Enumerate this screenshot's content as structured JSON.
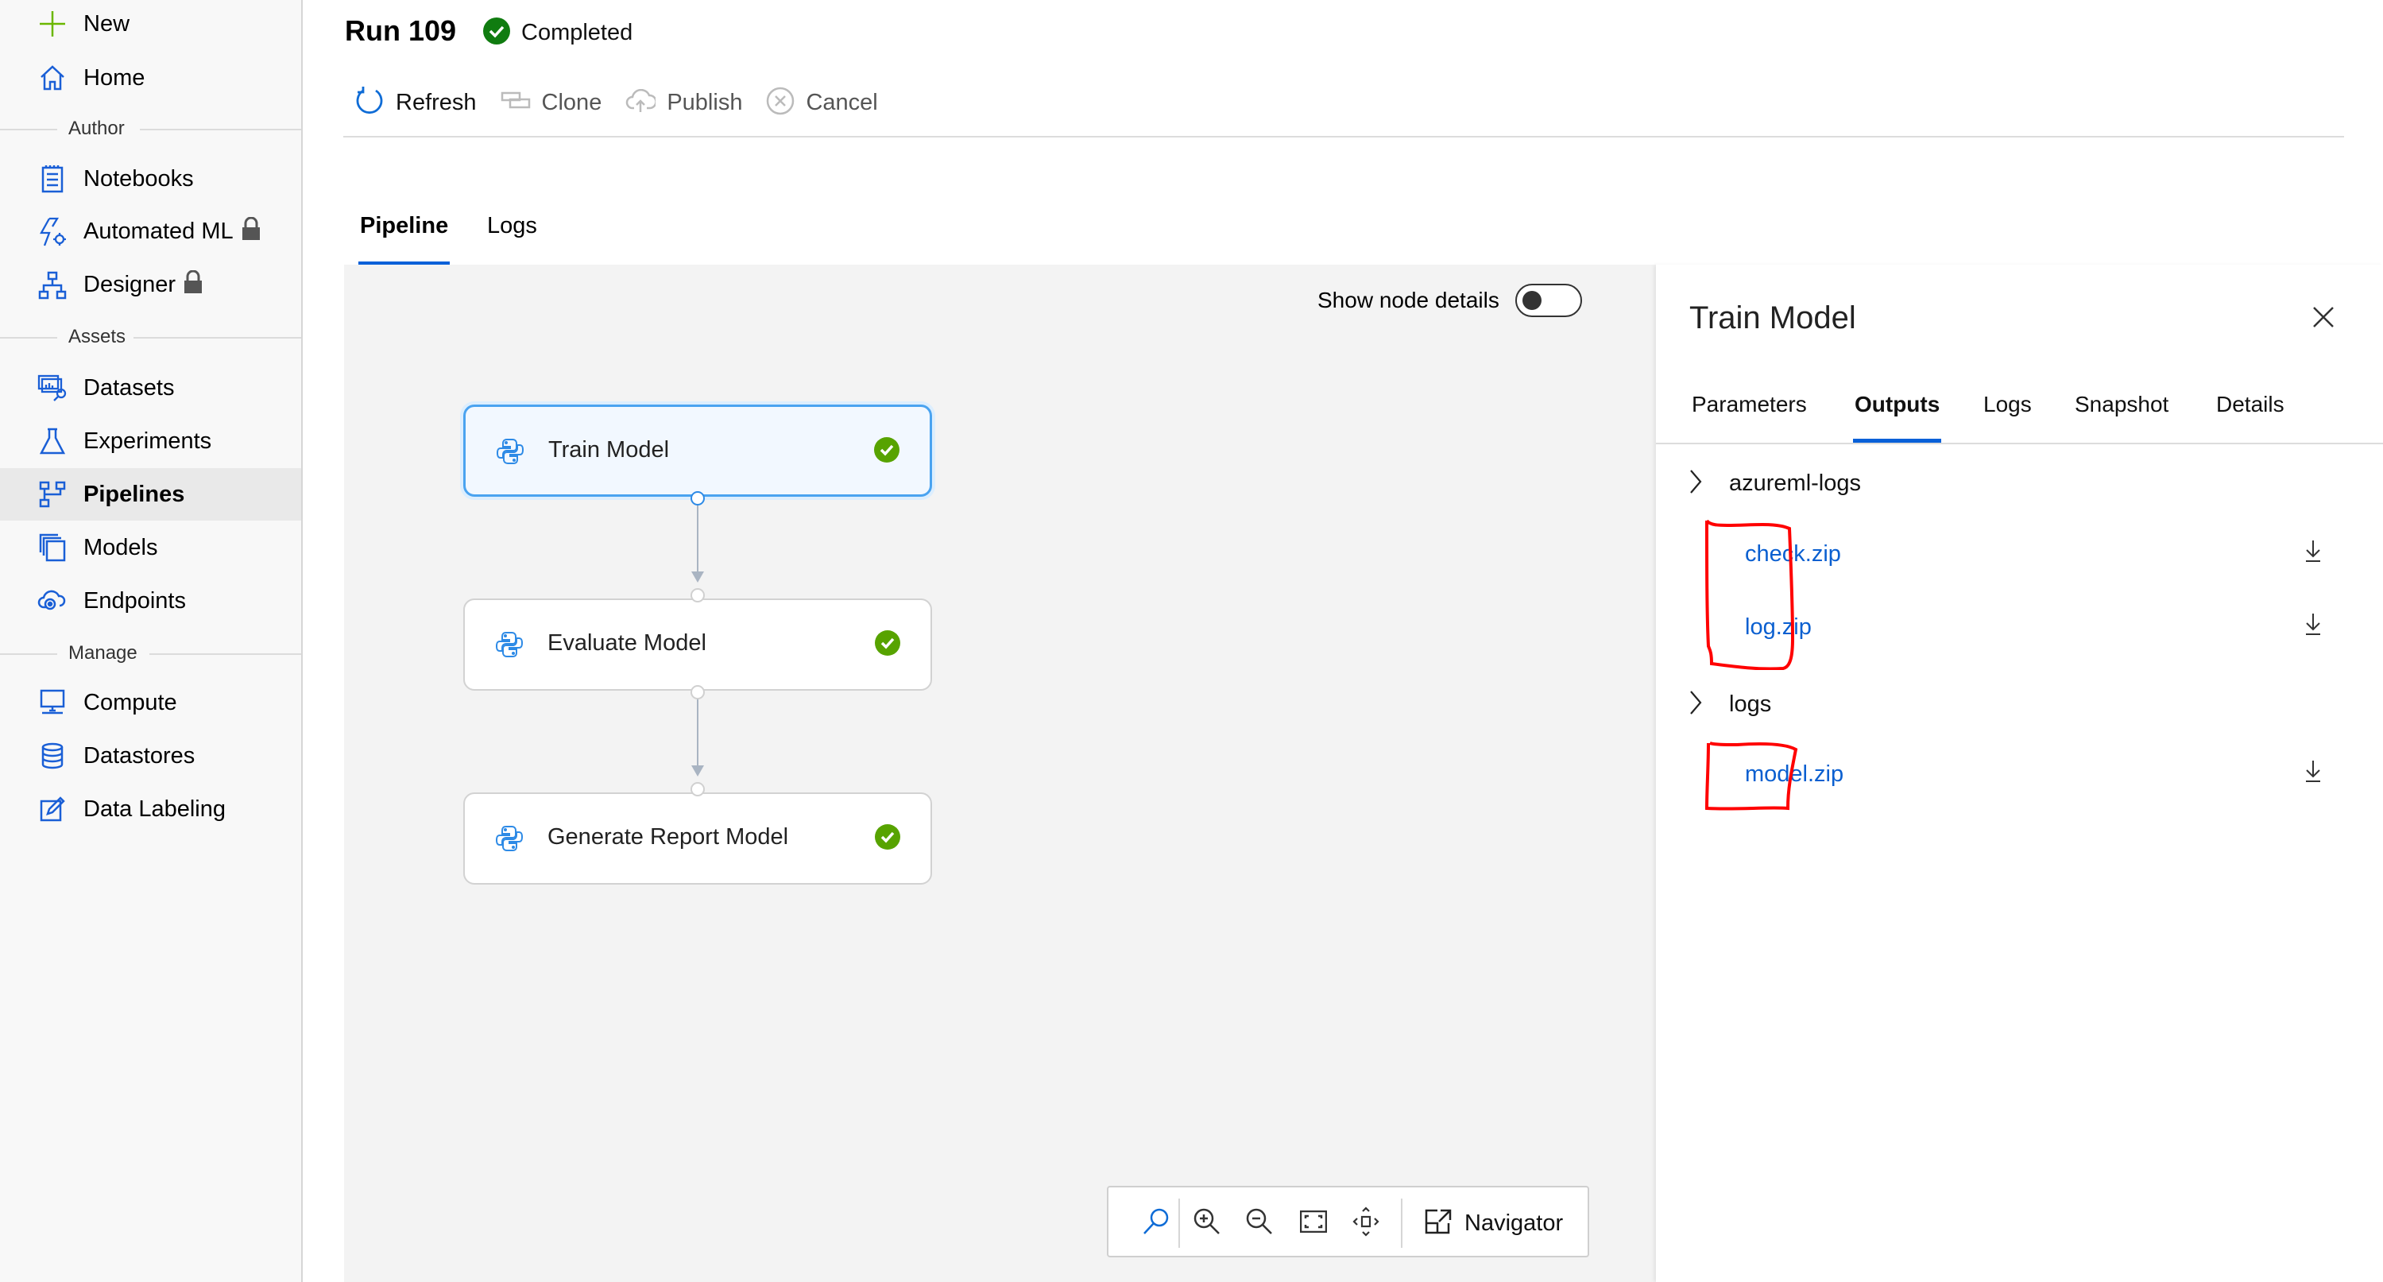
{
  "sidebar": {
    "new_label": "New",
    "home_label": "Home",
    "sections": {
      "author": "Author",
      "assets": "Assets",
      "manage": "Manage"
    },
    "items": [
      {
        "label": "Notebooks",
        "icon": "notebook-icon"
      },
      {
        "label": "Automated ML",
        "icon": "automated-ml-icon",
        "locked": true
      },
      {
        "label": "Designer",
        "icon": "designer-icon",
        "locked": true
      },
      {
        "label": "Datasets",
        "icon": "datasets-icon"
      },
      {
        "label": "Experiments",
        "icon": "flask-icon"
      },
      {
        "label": "Pipelines",
        "icon": "pipeline-icon",
        "active": true
      },
      {
        "label": "Models",
        "icon": "models-icon"
      },
      {
        "label": "Endpoints",
        "icon": "endpoints-icon"
      },
      {
        "label": "Compute",
        "icon": "compute-icon"
      },
      {
        "label": "Datastores",
        "icon": "database-icon"
      },
      {
        "label": "Data Labeling",
        "icon": "edit-icon"
      }
    ]
  },
  "header": {
    "title": "Run 109",
    "status": "Completed",
    "status_color": "#107c10"
  },
  "toolbar": {
    "refresh": "Refresh",
    "clone": "Clone",
    "publish": "Publish",
    "cancel": "Cancel"
  },
  "tabs": [
    {
      "label": "Pipeline",
      "active": true
    },
    {
      "label": "Logs"
    }
  ],
  "canvas": {
    "show_node_details_label": "Show node details",
    "show_node_details_on": false,
    "nodes": [
      {
        "name": "Train Model",
        "status": "completed",
        "selected": true
      },
      {
        "name": "Evaluate Model",
        "status": "completed"
      },
      {
        "name": "Generate Report Model",
        "status": "completed"
      }
    ],
    "navigator_label": "Navigator"
  },
  "panel": {
    "title": "Train Model",
    "tabs": [
      {
        "label": "Parameters"
      },
      {
        "label": "Outputs",
        "active": true
      },
      {
        "label": "Logs"
      },
      {
        "label": "Snapshot"
      },
      {
        "label": "Details"
      }
    ],
    "outputs": {
      "folders": [
        {
          "name": "azureml-logs",
          "files": [
            "check.zip",
            "log.zip"
          ]
        },
        {
          "name": "logs",
          "files": [
            "model.zip"
          ]
        }
      ]
    }
  },
  "colors": {
    "accent": "#0860d8",
    "success": "#57a300",
    "annotation": "#ff0000"
  }
}
